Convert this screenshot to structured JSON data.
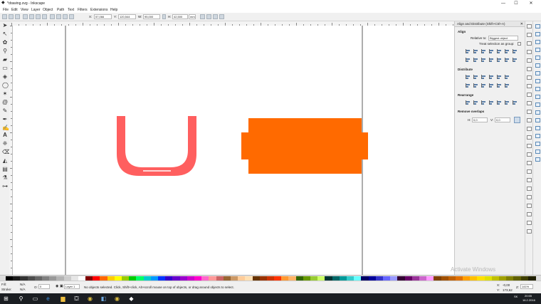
{
  "window": {
    "title": "*drawing.svg - Inkscape",
    "minimize": "—",
    "maximize": "☐",
    "close": "✕"
  },
  "menu": [
    "File",
    "Edit",
    "View",
    "Layer",
    "Object",
    "Path",
    "Text",
    "Filters",
    "Extensions",
    "Help"
  ],
  "toolcontrols": {
    "x_label": "X:",
    "x_value": "57,066",
    "y_label": "Y:",
    "y_value": "120,544",
    "w_label": "W:",
    "w_value": "95,000",
    "h_label": "H:",
    "h_value": "42,500",
    "unit": "mm"
  },
  "panel": {
    "header": "Align and Distribute (Shift+Ctrl+A)",
    "align_title": "Align",
    "relative_to_label": "Relative to:",
    "relative_to_value": "Biggest object",
    "treat_as_group": "Treat selection as group:",
    "distribute_title": "Distribute",
    "rearrange_title": "Rearrange",
    "remove_overlaps_title": "Remove overlaps",
    "h_label": "H:",
    "h_value": "0,0",
    "v_label": "V:",
    "v_value": "0,0"
  },
  "canvas": {
    "shape_u_color": "#ff5f5f",
    "shape_rect_color": "#ff6a00"
  },
  "palette": {
    "colors": [
      "#000000",
      "#1a1a1a",
      "#333333",
      "#4d4d4d",
      "#666666",
      "#808080",
      "#999999",
      "#b3b3b3",
      "#cccccc",
      "#e6e6e6",
      "#ffffff",
      "#800000",
      "#ff0000",
      "#ff6600",
      "#ffcc00",
      "#ffff00",
      "#99cc00",
      "#00cc00",
      "#00ff66",
      "#00cccc",
      "#0099ff",
      "#0033ff",
      "#3300cc",
      "#6600cc",
      "#9900cc",
      "#cc00cc",
      "#ff00cc",
      "#ff66cc",
      "#ff9999",
      "#cc6666",
      "#996633",
      "#cc9966",
      "#ffcc99",
      "#ffe0b3",
      "#663300",
      "#993300",
      "#cc3300",
      "#ff3300",
      "#ff9933",
      "#ffb366",
      "#336600",
      "#669900",
      "#99cc33",
      "#ccff66",
      "#003333",
      "#006666",
      "#009999",
      "#33cccc",
      "#66ffff",
      "#000066",
      "#000099",
      "#3333cc",
      "#6666ff",
      "#9999ff",
      "#330033",
      "#660066",
      "#993399",
      "#cc66cc",
      "#ff99ff",
      "#804000",
      "#a05000",
      "#c06000",
      "#e07000",
      "#ffa000",
      "#ffc000",
      "#ffe000",
      "#e0e000",
      "#c0c000",
      "#a0a000",
      "#808000",
      "#606000",
      "#404000",
      "#202000"
    ]
  },
  "status": {
    "fill_label": "Fill:",
    "fill_value": "N/A",
    "stroke_label": "Stroke:",
    "stroke_value": "N/A",
    "opacity_label": "O:",
    "opacity_value": "0",
    "layer_value": "Layer 1",
    "message": "No objects selected. Click, Shift+click, Alt+scroll mouse on top of objects, or drag around objects to select.",
    "x_label": "X:",
    "x_value": "-0,00",
    "y_label": "Y:",
    "y_value": "173,62",
    "z_label": "Z:",
    "z_value": "141%"
  },
  "watermark": "Activate Windows",
  "taskbar": {
    "time": "20:55",
    "date": "16.2.2016",
    "lang": "SK"
  }
}
